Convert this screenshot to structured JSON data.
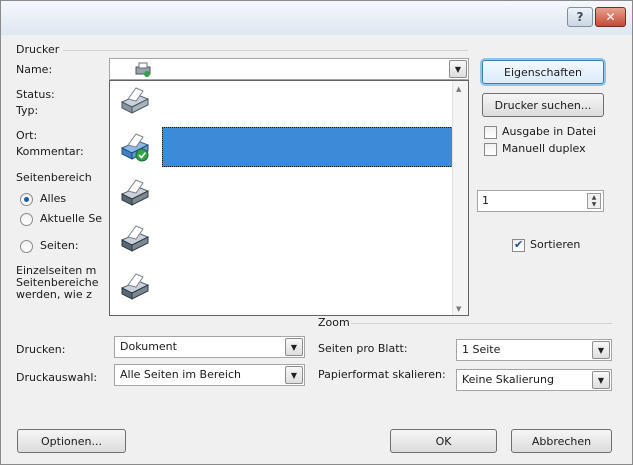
{
  "titlebar": {
    "help": "?",
    "close": "✕"
  },
  "printer": {
    "group_title": "Drucker",
    "name_label": "Name:",
    "status_label": "Status:",
    "type_label": "Typ:",
    "location_label": "Ort:",
    "comment_label": "Kommentar:",
    "properties_button": "Eigenschaften",
    "find_printer_button": "Drucker suchen...",
    "print_to_file_label": "Ausgabe in Datei",
    "manual_duplex_label": "Manuell duplex"
  },
  "printer_list": {
    "items": [
      {
        "icon": "printer-icon",
        "selected": false
      },
      {
        "icon": "printer-default-icon",
        "selected": true
      },
      {
        "icon": "printer-icon",
        "selected": false
      },
      {
        "icon": "printer-icon",
        "selected": false
      },
      {
        "icon": "printer-icon",
        "selected": false
      }
    ]
  },
  "range": {
    "group_title": "Seitenbereich",
    "all_label": "Alles",
    "current_label": "Aktuelle Se",
    "pages_label": "Seiten:",
    "hint_line1": "Einzelseiten m",
    "hint_line2": "Seitenbereiche",
    "hint_line3": "werden, wie z"
  },
  "copies": {
    "value": "1",
    "collate_label": "Sortieren"
  },
  "print_what": {
    "label": "Drucken:",
    "value": "Dokument"
  },
  "print_selection": {
    "label": "Druckauswahl:",
    "value": "Alle Seiten im Bereich"
  },
  "zoom": {
    "group_title": "Zoom",
    "pages_per_sheet_label": "Seiten pro Blatt:",
    "pages_per_sheet_value": "1 Seite",
    "scale_label": "Papierformat skalieren:",
    "scale_value": "Keine Skalierung"
  },
  "footer": {
    "options_button": "Optionen...",
    "ok_button": "OK",
    "cancel_button": "Abbrechen"
  }
}
